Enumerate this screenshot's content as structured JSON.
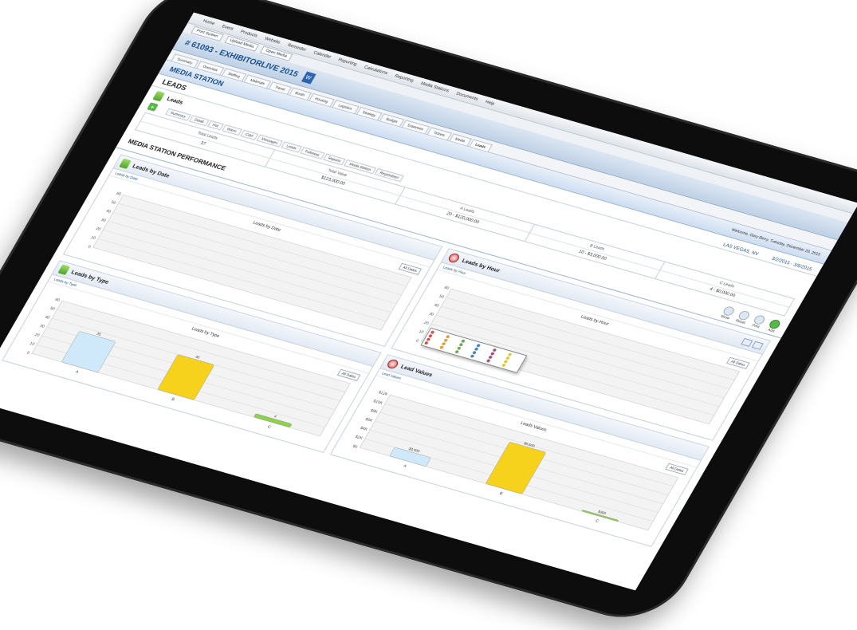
{
  "topmenu": [
    "Home",
    "Event",
    "Products",
    "Website",
    "Reminder",
    "Calendar",
    "Reporting",
    "Calculations",
    "Reporting",
    "Media Stations",
    "Documents",
    "Help"
  ],
  "toolbar": {
    "btn1": "Print Screen",
    "btn2": "Upload Media",
    "btn3": "Open Media"
  },
  "event": {
    "title": "# 61093 - EXHIBITORLIVE 2015",
    "doc_icon": "W"
  },
  "tabs": [
    "Summary",
    "Overview",
    "Staffing",
    "Materials",
    "Travel",
    "Booth",
    "Housing",
    "Logistics",
    "Strategy",
    "Budget",
    "Expenses",
    "Tickets",
    "Media",
    "Leads"
  ],
  "active_tab_index": 13,
  "section": {
    "title": "MEDIA STATION",
    "welcome": "Welcome, Gary Berry. Tuesday, December 29, 2015"
  },
  "leads": {
    "title": "LEADS",
    "location": "LAS VEGAS, NV",
    "dates": "3/2/2015 - 3/6/2015"
  },
  "leads_sub": {
    "label": "Leads"
  },
  "subtabs": [
    "Summary",
    "Detail",
    "Hot",
    "Warm",
    "Cold",
    "Messages",
    "Leads",
    "Followup",
    "Reports",
    "Media Station",
    "Registration"
  ],
  "summary": {
    "cols": [
      {
        "label": "Total Leads",
        "value": "37"
      },
      {
        "label": "Total Value",
        "value": "$123,000.00"
      },
      {
        "label": "A Leads",
        "value": "20 - $120,000.00"
      },
      {
        "label": "B Leads",
        "value": "10 - $3,000.00"
      },
      {
        "label": "C Leads",
        "value": "4 - $0,000.00"
      }
    ]
  },
  "performance": {
    "title": "MEDIA STATION PERFORMANCE",
    "actions": [
      "Show",
      "Reset",
      "Print",
      "Add"
    ]
  },
  "panels": {
    "by_date": {
      "title": "Leads by Date",
      "sub": "Leads by Date",
      "chart_title": "Leads by Date",
      "select": "All Dates"
    },
    "by_hour": {
      "title": "Leads by Hour",
      "sub": "Leads by Hour",
      "chart_title": "Leads by Hour",
      "select": "All Dates"
    },
    "by_type": {
      "title": "Leads by Type",
      "sub": "Leads by Type",
      "chart_title": "Leads by Type",
      "select": "All Dates"
    },
    "values": {
      "title": "Lead Values",
      "sub": "Lead Values",
      "chart_title": "Leads Values",
      "select": "All Dates"
    }
  },
  "chart_data": [
    {
      "type": "line",
      "title": "Leads by Date",
      "ylim": [
        0,
        60
      ],
      "yticks": [
        "0",
        "10",
        "20",
        "30",
        "40",
        "50",
        "60"
      ],
      "x": [],
      "series": []
    },
    {
      "type": "line",
      "title": "Leads by Hour",
      "ylim": [
        0,
        60
      ],
      "yticks": [
        "0",
        "10",
        "20",
        "30",
        "40",
        "50",
        "60"
      ],
      "x": [],
      "series": []
    },
    {
      "type": "bar",
      "title": "Leads by Type",
      "categories": [
        "A",
        "B",
        "C"
      ],
      "values": [
        35,
        40,
        4
      ],
      "ylim": [
        0,
        60
      ],
      "yticks": [
        "0",
        "10",
        "20",
        "30",
        "40",
        "50",
        "60"
      ],
      "colors": [
        "#cfe9fb",
        "#f6d21d",
        "#8bd14a"
      ]
    },
    {
      "type": "bar",
      "title": "Leads Values",
      "categories": [
        "A",
        "B",
        "C"
      ],
      "values": [
        2000,
        9500,
        300
      ],
      "data_labels": [
        "$3,000",
        "$9,500",
        "$300"
      ],
      "ylim": [
        0,
        12000
      ],
      "yticks": [
        "$0",
        "$2K",
        "$4K",
        "$6K",
        "$8K",
        "$10K",
        "$12K"
      ],
      "colors": [
        "#cfe9fb",
        "#f6d21d",
        "#8bd14a"
      ]
    }
  ]
}
